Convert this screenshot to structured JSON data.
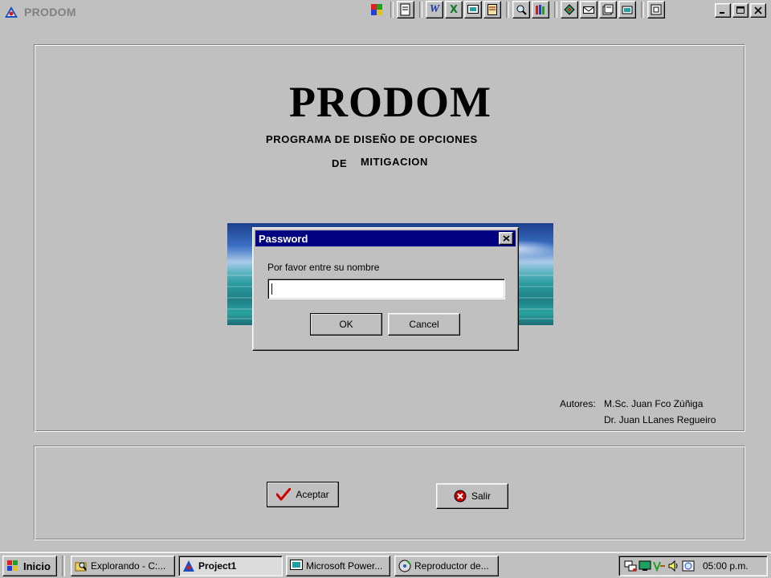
{
  "window": {
    "title": "PRODOM"
  },
  "office_toolbar": {
    "buttons": [
      "office-logo-icon",
      "new-doc-icon",
      "word-icon",
      "excel-icon",
      "powerpoint-icon",
      "access-icon",
      "find-icon",
      "bookshelf-icon",
      "schedule-icon",
      "mail-icon",
      "contacts-icon",
      "binder-icon",
      "shortcut-icon"
    ]
  },
  "main": {
    "heading": "PRODOM",
    "subtitle_line1": "PROGRAMA DE DISEÑO DE  OPCIONES",
    "subtitle_line2a": "DE",
    "subtitle_line2b": "MITIGACION",
    "authors_label": "Autores:",
    "author_1": "M.Sc.  Juan Fco Zúñiga",
    "author_2": "Dr. Juan LLanes Regueiro"
  },
  "buttons": {
    "aceptar": "Aceptar",
    "salir": "Salir"
  },
  "dialog": {
    "title": "Password",
    "prompt": "Por favor entre su nombre",
    "input_value": "",
    "ok": "OK",
    "cancel": "Cancel"
  },
  "taskbar": {
    "start": "Inicio",
    "tasks": [
      {
        "label": "Explorando - C:..."
      },
      {
        "label": "Project1",
        "active": true
      },
      {
        "label": "Microsoft Power..."
      },
      {
        "label": "Reproductor de..."
      }
    ],
    "clock": "05:00 p.m."
  },
  "colors": {
    "face": "#c0c0c0",
    "title_active": "#000080",
    "title_inactive_text": "#808080",
    "check_red": "#cc0000"
  }
}
